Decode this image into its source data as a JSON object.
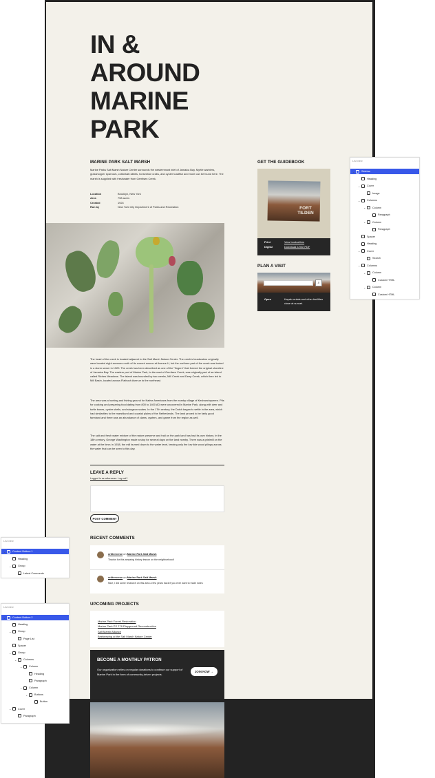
{
  "page": {
    "title": "IN & AROUND MARINE PARK"
  },
  "main": {
    "section_heading": "MARINE PARK SALT MARSH",
    "intro": "Marine Parks Salt Marsh Nature Center surrounds the westernmost inlet of Jamaica Bay. Myrtle warblers, grasshopper sparrows, cottontail rabbits, horseshoe crabs, and oyster toadfish and more can be found here. The marsh is supplied with freshwater from Gerritsen Creek.",
    "details": [
      {
        "key": "Location",
        "value": "Brooklyn, New York"
      },
      {
        "key": "Area",
        "value": "798 acres"
      },
      {
        "key": "Created",
        "value": "1924"
      },
      {
        "key": "Run by",
        "value": "New York City Department of Parks and Recreation"
      }
    ],
    "body_1": "The head of the creek is located adjacent to the Salt Marsh Nature Center. The creek's headwaters originally were located eight avenues north of its current source at Avenue U, but the northern part of the creek was buried in a storm sewer in 1920. The creek has been described as one of the \"fingers\" that formed the original shoreline of Jamaica Bay. The eastern part of Marine Park, to the east of Gerritsen Creek, was originally part of an island called Riches Meadows. The island was bounded by two creeks, Mill Creek and Deep Creek, which then led to Mill Basin, located across Flatbush Avenue to the northeast.",
    "body_2": "The area was a hunting and fishing ground for Native Americans from the nearby village of Keshaechqueren. Pits for cooking and preparing food dating from 800 to 1400 AD were uncovered in Marine Park, along with deer and turtle bones, oyster shells, and sturgeon scales. In the 17th century, the Dutch began to settle in the area, which had similarities to the marshland and coastal plains of the Netherlands. The land proved to be fairly good farmland and there was an abundance of clams, oysters, and game from the region as well.",
    "body_3": "The salt and fresh water mixture of the nature preserve and trail on the park land has had its own history. In the 18th century, George Washington made a stop for several days on the land nearby. There was a gristmill on the water at the time; in 1938, the mill burned down to the water level, leaving only the low tide wood pilings across the water that can be seen to this day."
  },
  "reply": {
    "heading": "LEAVE A REPLY",
    "logged_in": "Logged in as criterverse. Log out?",
    "button": "POST COMMENT"
  },
  "recent": {
    "heading": "RECENT COMMENTS",
    "comments": [
      {
        "author": "crtiterverse",
        "on": "on",
        "post": "Marine Park Salt Marsh",
        "text": "Thanks for this amazing history lesson on the neighborhood!"
      },
      {
        "author": "crtiterverse",
        "on": "on",
        "post": "Marine Park Salt Marsh",
        "text": "Nice, I did some research on this area a few years back if you ever want to trade notes"
      }
    ]
  },
  "projects": {
    "heading": "UPCOMING PROJECTS",
    "items": [
      "Marine Park Forest Restoration",
      "Marine Park PS 278 Playground Reconstruction",
      "Salt Marsh Alliance",
      "Beekeeping at the Salt Marsh Nature Center"
    ]
  },
  "patron": {
    "heading": "BECOME A MONTHLY PATRON",
    "text": "Our organization relies on regular donations to continue our support of Marine Park in the form of community-driven projects.",
    "button": "JOIN NOW →"
  },
  "guide": {
    "heading": "GET THE GUIDEBOOK",
    "book_text": "FORT TILDEN",
    "print_label": "Print",
    "print_link": "View booksellers",
    "digital_label": "Digital",
    "digital_link": "Download a free PDF"
  },
  "visit": {
    "heading": "PLAN A VISIT",
    "open_label": "Open",
    "open_text": "Kayak rentals and other facilities close at sunset."
  },
  "list_view_right": {
    "caption": "List view",
    "rows": [
      {
        "label": "Sidebar",
        "icon": "template-part-icon",
        "level": 0,
        "chev": "v",
        "selected": true
      },
      {
        "label": "Heading",
        "icon": "bookmark-icon",
        "level": 1,
        "chev": ""
      },
      {
        "label": "Cover",
        "icon": "cover-icon",
        "level": 1,
        "chev": "v"
      },
      {
        "label": "Image",
        "icon": "image-icon",
        "level": 2,
        "chev": ""
      },
      {
        "label": "Columns",
        "icon": "columns-icon",
        "level": 1,
        "chev": "v"
      },
      {
        "label": "Column",
        "icon": "column-icon",
        "level": 2,
        "chev": "v"
      },
      {
        "label": "Paragraph",
        "icon": "paragraph-icon",
        "level": 3,
        "chev": ""
      },
      {
        "label": "Column",
        "icon": "column-icon",
        "level": 2,
        "chev": "v"
      },
      {
        "label": "Paragraph",
        "icon": "paragraph-icon",
        "level": 3,
        "chev": ""
      },
      {
        "label": "Spacer",
        "icon": "spacer-icon",
        "level": 1,
        "chev": ""
      },
      {
        "label": "Heading",
        "icon": "bookmark-icon",
        "level": 1,
        "chev": ""
      },
      {
        "label": "Cover",
        "icon": "cover-icon",
        "level": 1,
        "chev": "v"
      },
      {
        "label": "Search",
        "icon": "search-icon",
        "level": 2,
        "chev": ""
      },
      {
        "label": "Columns",
        "icon": "columns-icon",
        "level": 1,
        "chev": "v"
      },
      {
        "label": "Column",
        "icon": "column-icon",
        "level": 2,
        "chev": "v"
      },
      {
        "label": "Custom HTML",
        "icon": "html-icon",
        "level": 3,
        "chev": ""
      },
      {
        "label": "Column",
        "icon": "column-icon",
        "level": 2,
        "chev": "v"
      },
      {
        "label": "Custom HTML",
        "icon": "html-icon",
        "level": 3,
        "chev": ""
      }
    ]
  },
  "list_view_left1": {
    "caption": "List view",
    "rows": [
      {
        "label": "Content Bottom 1",
        "icon": "template-part-icon",
        "level": 0,
        "chev": "v",
        "selected": true
      },
      {
        "label": "Heading",
        "icon": "bookmark-icon",
        "level": 1,
        "chev": ""
      },
      {
        "label": "Group",
        "icon": "group-icon",
        "level": 1,
        "chev": "v"
      },
      {
        "label": "Latest Comments",
        "icon": "comment-icon",
        "level": 2,
        "chev": ""
      }
    ]
  },
  "list_view_left2": {
    "caption": "List view",
    "rows": [
      {
        "label": "Content Bottom 2",
        "icon": "template-part-icon",
        "level": 0,
        "chev": "v",
        "selected": true
      },
      {
        "label": "Heading",
        "icon": "bookmark-icon",
        "level": 1,
        "chev": ""
      },
      {
        "label": "Group",
        "icon": "group-icon",
        "level": 1,
        "chev": "v"
      },
      {
        "label": "Page List",
        "icon": "page-list-icon",
        "level": 2,
        "chev": ""
      },
      {
        "label": "Spacer",
        "icon": "spacer-icon",
        "level": 1,
        "chev": ""
      },
      {
        "label": "Group",
        "icon": "group-icon",
        "level": 1,
        "chev": "v"
      },
      {
        "label": "Columns",
        "icon": "columns-icon",
        "level": 2,
        "chev": "v"
      },
      {
        "label": "Column",
        "icon": "column-icon",
        "level": 3,
        "chev": "v"
      },
      {
        "label": "Heading",
        "icon": "bookmark-icon",
        "level": 4,
        "chev": ""
      },
      {
        "label": "Paragraph",
        "icon": "paragraph-icon",
        "level": 4,
        "chev": ""
      },
      {
        "label": "Column",
        "icon": "column-icon",
        "level": 3,
        "chev": "v"
      },
      {
        "label": "Buttons",
        "icon": "buttons-icon",
        "level": 4,
        "chev": "v"
      },
      {
        "label": "Button",
        "icon": "button-icon",
        "level": 5,
        "chev": ""
      },
      {
        "label": "Cover",
        "icon": "cover-icon",
        "level": 1,
        "chev": "v"
      },
      {
        "label": "Paragraph",
        "icon": "paragraph-icon",
        "level": 2,
        "chev": ""
      }
    ]
  }
}
